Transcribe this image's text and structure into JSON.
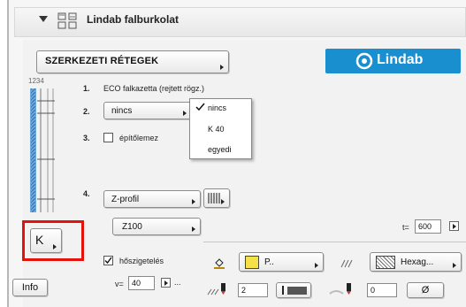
{
  "header": {
    "title": "Lindab falburkolat"
  },
  "top_button": {
    "label": "SZERKEZETI RÉTEGEK"
  },
  "logo": {
    "text": "Lindab"
  },
  "layer_numbers": "1234",
  "rows": {
    "r1": {
      "num": "1.",
      "label": "ECO falkazetta (rejtett rögz.)"
    },
    "r2": {
      "num": "2.",
      "value": "nincs"
    },
    "r3": {
      "num": "3.",
      "label": "építőlemez"
    },
    "r4": {
      "num": "4.",
      "profile": "Z-profil",
      "size": "Z100",
      "t_label": "t=",
      "t_value": "600"
    }
  },
  "dropdown": {
    "items": [
      "nincs",
      "K 40",
      "egyedi"
    ],
    "selected": "nincs"
  },
  "k_button": {
    "label": "K"
  },
  "insulation": {
    "label": "hőszigetelés",
    "checked": true,
    "v_label": "v=",
    "v_value": "40",
    "ellipsis": "..."
  },
  "fill": {
    "pen_label": "P..",
    "pattern_label": "Hexag...",
    "pen_value": "2",
    "second_value": "0",
    "null_symbol": "Ø"
  },
  "info_button": {
    "label": "Info"
  },
  "colors": {
    "logo_bg": "#1a8fd0",
    "highlight": "#e3120b",
    "fill_yellow": "#f4e14a"
  }
}
